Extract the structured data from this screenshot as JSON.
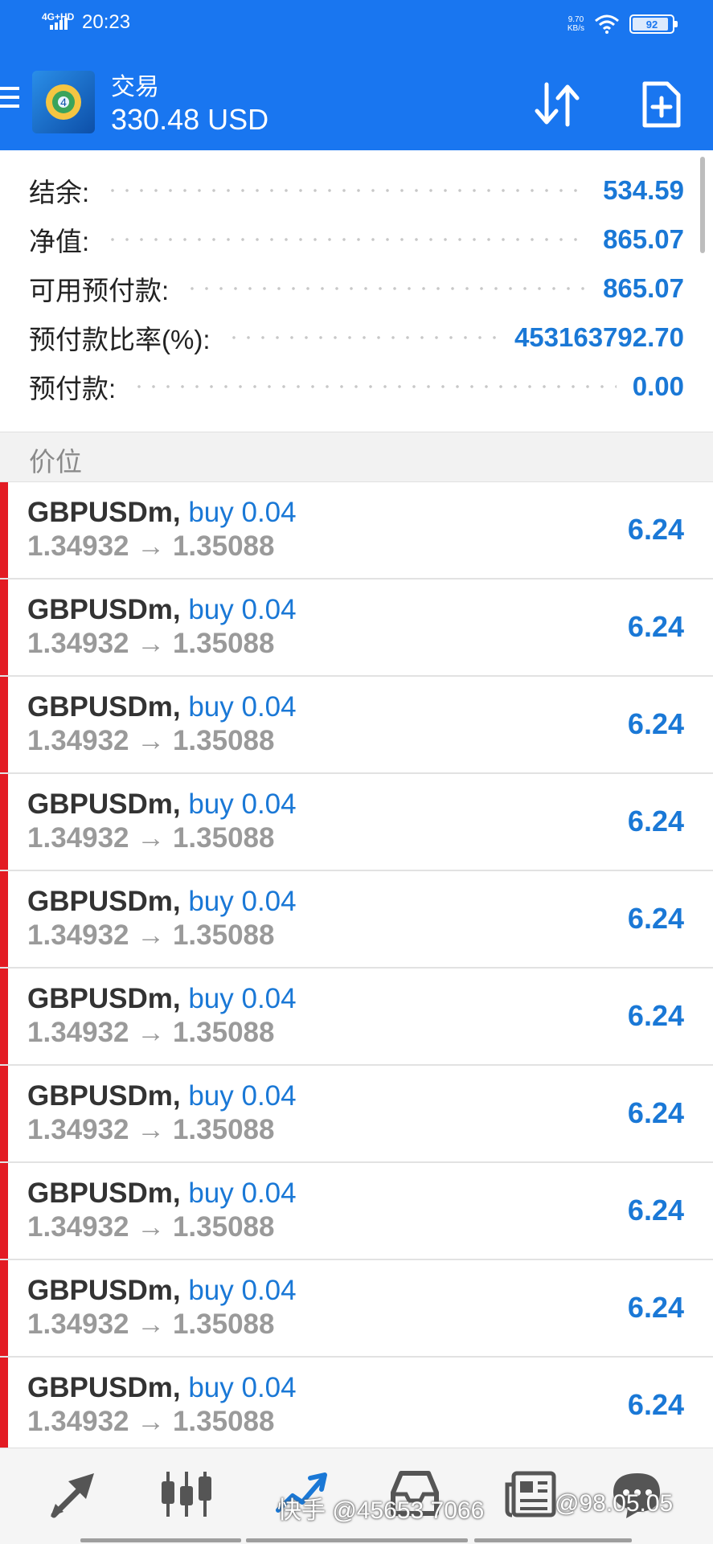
{
  "status_bar": {
    "network": "4G+HD",
    "time": "20:23",
    "speed_value": "9.70",
    "speed_unit": "KB/s",
    "battery": "92"
  },
  "header": {
    "title": "交易",
    "balance": "330.48 USD",
    "icons": {
      "menu": "hamburger-menu-icon",
      "logo": "metatrader-logo-icon",
      "sort": "sort-arrows-icon",
      "new_order": "new-order-icon"
    }
  },
  "summary": [
    {
      "label": "结余:",
      "value": "534.59"
    },
    {
      "label": "净值:",
      "value": "865.07"
    },
    {
      "label": "可用预付款:",
      "value": "865.07"
    },
    {
      "label": "预付款比率(%):",
      "value": "453163792.70"
    },
    {
      "label": "预付款:",
      "value": "0.00"
    }
  ],
  "section_title": "价位",
  "positions": [
    {
      "symbol": "GBPUSDm,",
      "direction": "buy 0.04",
      "prices": "1.34932 → 1.35088",
      "profit": "6.24"
    },
    {
      "symbol": "GBPUSDm,",
      "direction": "buy 0.04",
      "prices": "1.34932 → 1.35088",
      "profit": "6.24"
    },
    {
      "symbol": "GBPUSDm,",
      "direction": "buy 0.04",
      "prices": "1.34932 → 1.35088",
      "profit": "6.24"
    },
    {
      "symbol": "GBPUSDm,",
      "direction": "buy 0.04",
      "prices": "1.34932 → 1.35088",
      "profit": "6.24"
    },
    {
      "symbol": "GBPUSDm,",
      "direction": "buy 0.04",
      "prices": "1.34932 → 1.35088",
      "profit": "6.24"
    },
    {
      "symbol": "GBPUSDm,",
      "direction": "buy 0.04",
      "prices": "1.34932 → 1.35088",
      "profit": "6.24"
    },
    {
      "symbol": "GBPUSDm,",
      "direction": "buy 0.04",
      "prices": "1.34932 → 1.35088",
      "profit": "6.24"
    },
    {
      "symbol": "GBPUSDm,",
      "direction": "buy 0.04",
      "prices": "1.34932 → 1.35088",
      "profit": "6.24"
    },
    {
      "symbol": "GBPUSDm,",
      "direction": "buy 0.04",
      "prices": "1.34932 → 1.35088",
      "profit": "6.24"
    },
    {
      "symbol": "GBPUSDm,",
      "direction": "buy 0.04",
      "prices": "1.34932 → 1.35088",
      "profit": "6.24"
    }
  ],
  "bottom_nav": {
    "icons": [
      "quotes-arrows-icon",
      "chart-candles-icon",
      "trade-line-icon",
      "history-inbox-icon",
      "news-icon",
      "messages-icon"
    ]
  },
  "watermark": {
    "left": "快手 @45653 7066",
    "right": "@98.05.05"
  },
  "colors": {
    "header": "#1976f0",
    "accent": "#1a78d6",
    "buy_bar": "#e31b23",
    "muted": "#9a9a9a"
  }
}
